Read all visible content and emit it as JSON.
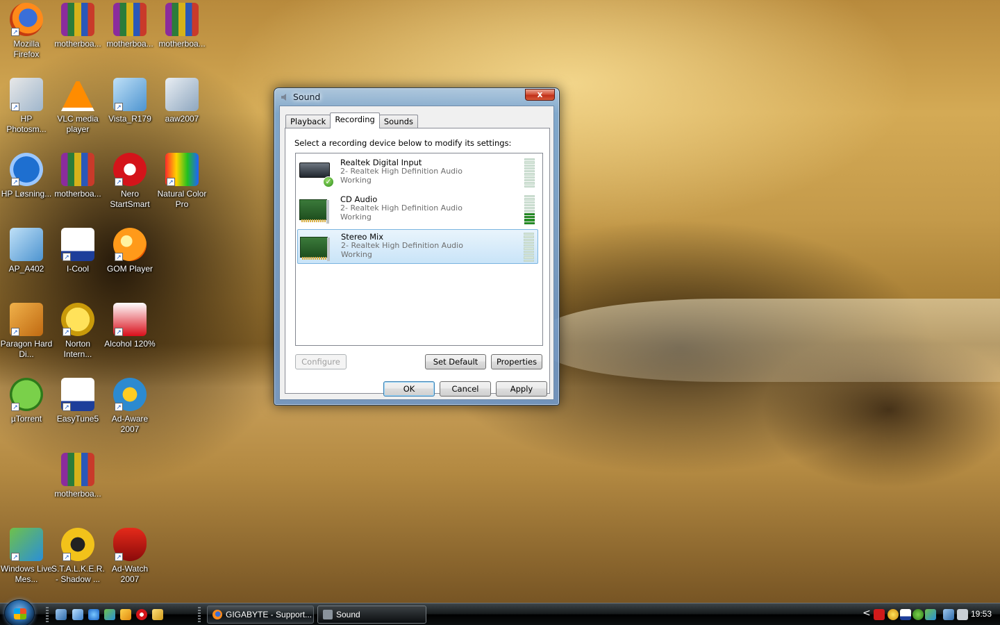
{
  "desktop": {
    "icons": [
      {
        "label": "Mozilla Firefox",
        "icon": "firefox-icon"
      },
      {
        "label": "motherboa...",
        "icon": "winrar-archive-icon"
      },
      {
        "label": "motherboa...",
        "icon": "winrar-archive-icon"
      },
      {
        "label": "motherboa...",
        "icon": "winrar-archive-icon"
      },
      {
        "label": "HP Photosm...",
        "icon": "hp-photosmart-icon"
      },
      {
        "label": "VLC media player",
        "icon": "vlc-icon"
      },
      {
        "label": "Vista_R179",
        "icon": "driver-installer-icon"
      },
      {
        "label": "aaw2007",
        "icon": "computer-icon"
      },
      {
        "label": "HP Løsning...",
        "icon": "hp-icon"
      },
      {
        "label": "motherboa...",
        "icon": "winrar-archive-icon"
      },
      {
        "label": "Nero StartSmart",
        "icon": "nero-icon"
      },
      {
        "label": "Natural Color Pro",
        "icon": "natural-color-icon"
      },
      {
        "label": "AP_A402",
        "icon": "driver-installer-icon"
      },
      {
        "label": "I-Cool",
        "icon": "gigabyte-icon"
      },
      {
        "label": "GOM Player",
        "icon": "gom-player-icon"
      },
      {
        "label": "Paragon Hard Di...",
        "icon": "paragon-icon"
      },
      {
        "label": "Norton Intern...",
        "icon": "norton-icon"
      },
      {
        "label": "Alcohol 120%",
        "icon": "alcohol-icon"
      },
      {
        "label": "µTorrent",
        "icon": "utorrent-icon"
      },
      {
        "label": "EasyTune5",
        "icon": "gigabyte-icon"
      },
      {
        "label": "Ad-Aware 2007",
        "icon": "adaware-icon"
      },
      {
        "label": "motherboa...",
        "icon": "winrar-archive-icon"
      },
      {
        "label": "Windows Live Mes...",
        "icon": "messenger-icon"
      },
      {
        "label": "S.T.A.L.K.E.R. - Shadow ...",
        "icon": "stalker-icon"
      },
      {
        "label": "Ad-Watch 2007",
        "icon": "adwatch-icon"
      }
    ]
  },
  "dialog": {
    "title": "Sound",
    "close_label": "x",
    "tabs": [
      "Playback",
      "Recording",
      "Sounds"
    ],
    "active_tab": "Recording",
    "instruction": "Select a recording device below to modify its settings:",
    "devices": [
      {
        "name": "Realtek Digital Input",
        "subtitle": "2- Realtek High Definition Audio",
        "status": "Working",
        "is_default": true,
        "level": 0,
        "selected": false
      },
      {
        "name": "CD Audio",
        "subtitle": "2- Realtek High Definition Audio",
        "status": "Working",
        "is_default": false,
        "level": 0.4,
        "selected": false
      },
      {
        "name": "Stereo Mix",
        "subtitle": "2- Realtek High Definition Audio",
        "status": "Working",
        "is_default": false,
        "level": 0,
        "selected": true
      }
    ],
    "buttons": {
      "configure": "Configure",
      "set_default": "Set Default",
      "properties": "Properties",
      "ok": "OK",
      "cancel": "Cancel",
      "apply": "Apply"
    }
  },
  "taskbar": {
    "windows": [
      {
        "label": "GIGABYTE - Support...",
        "icon": "firefox-icon",
        "active": false
      },
      {
        "label": "Sound",
        "icon": "speaker-icon",
        "active": true
      }
    ],
    "clock": "19:53",
    "tray_chevron": "<"
  }
}
